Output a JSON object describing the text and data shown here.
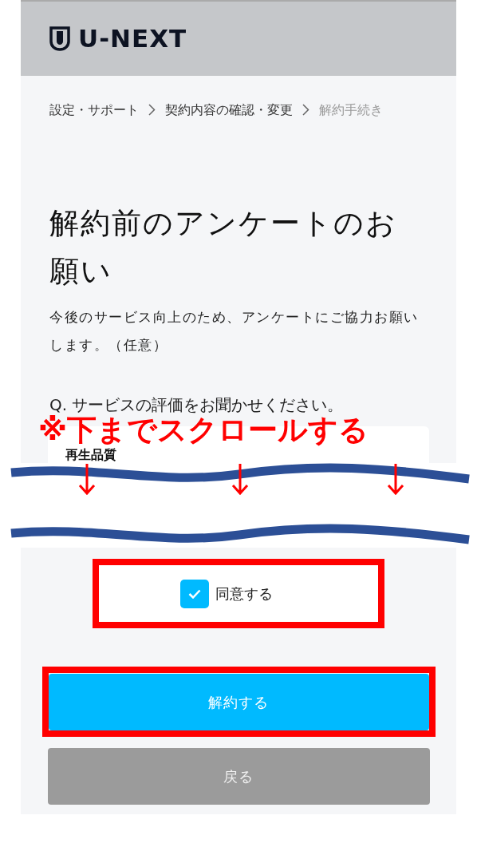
{
  "header": {
    "logo": "U-NEXT"
  },
  "breadcrumbs": [
    {
      "label": "設定・サポート",
      "current": false
    },
    {
      "label": "契約内容の確認・変更",
      "current": false
    },
    {
      "label": "解約手続き",
      "current": true
    }
  ],
  "title": "解約前のアンケートのお願い",
  "description": "今後のサービス向上のため、アンケートにご協力お願いします。（任意）",
  "question": "Q. サービスの評価をお聞かせください。",
  "rating_card": {
    "label": "再生品質"
  },
  "annotation": {
    "text": "※下までスクロールする"
  },
  "agree": {
    "label": "同意する",
    "checked": true
  },
  "buttons": [
    {
      "label": "解約する",
      "kind": "primary"
    },
    {
      "label": "戻る",
      "kind": "secondary"
    }
  ]
}
